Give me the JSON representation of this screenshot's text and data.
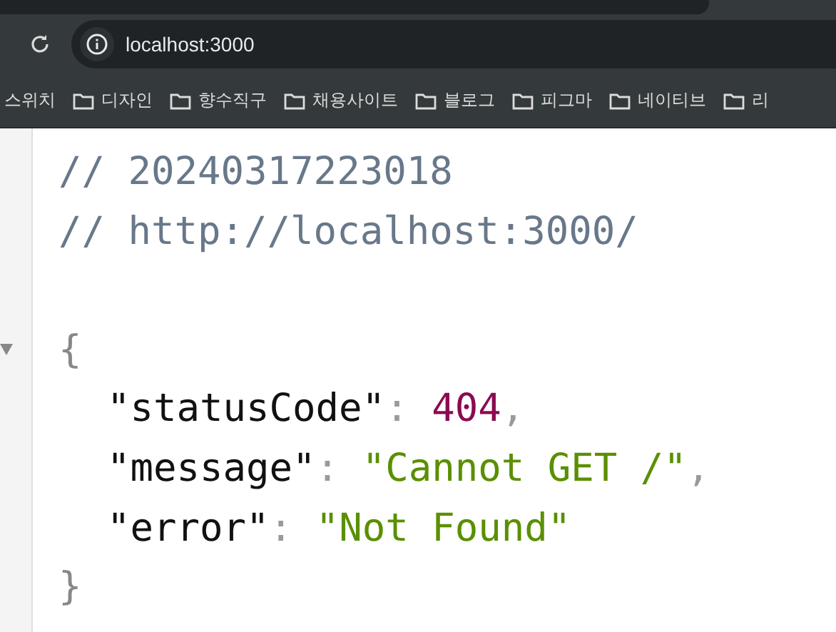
{
  "address_bar": {
    "url": "localhost:3000"
  },
  "bookmarks": [
    {
      "label": "스위치",
      "kind": "plain"
    },
    {
      "label": "디자인",
      "kind": "folder"
    },
    {
      "label": "향수직구",
      "kind": "folder"
    },
    {
      "label": "채용사이트",
      "kind": "folder"
    },
    {
      "label": "블로그",
      "kind": "folder"
    },
    {
      "label": "피그마",
      "kind": "folder"
    },
    {
      "label": "네이티브",
      "kind": "folder"
    },
    {
      "label": "리",
      "kind": "folder"
    }
  ],
  "viewer": {
    "comments": [
      "// 20240317223018",
      "// http://localhost:3000/"
    ],
    "open_brace": "{",
    "expanded": true,
    "entries": [
      {
        "key": "\"statusCode\"",
        "colon": ":",
        "value": "404",
        "kind": "number",
        "comma": ","
      },
      {
        "key": "\"message\"",
        "colon": ":",
        "value": "\"Cannot GET /\"",
        "kind": "string",
        "comma": ","
      },
      {
        "key": "\"error\"",
        "colon": ":",
        "value": "\"Not Found\"",
        "kind": "string"
      }
    ],
    "close_brace": "}"
  }
}
